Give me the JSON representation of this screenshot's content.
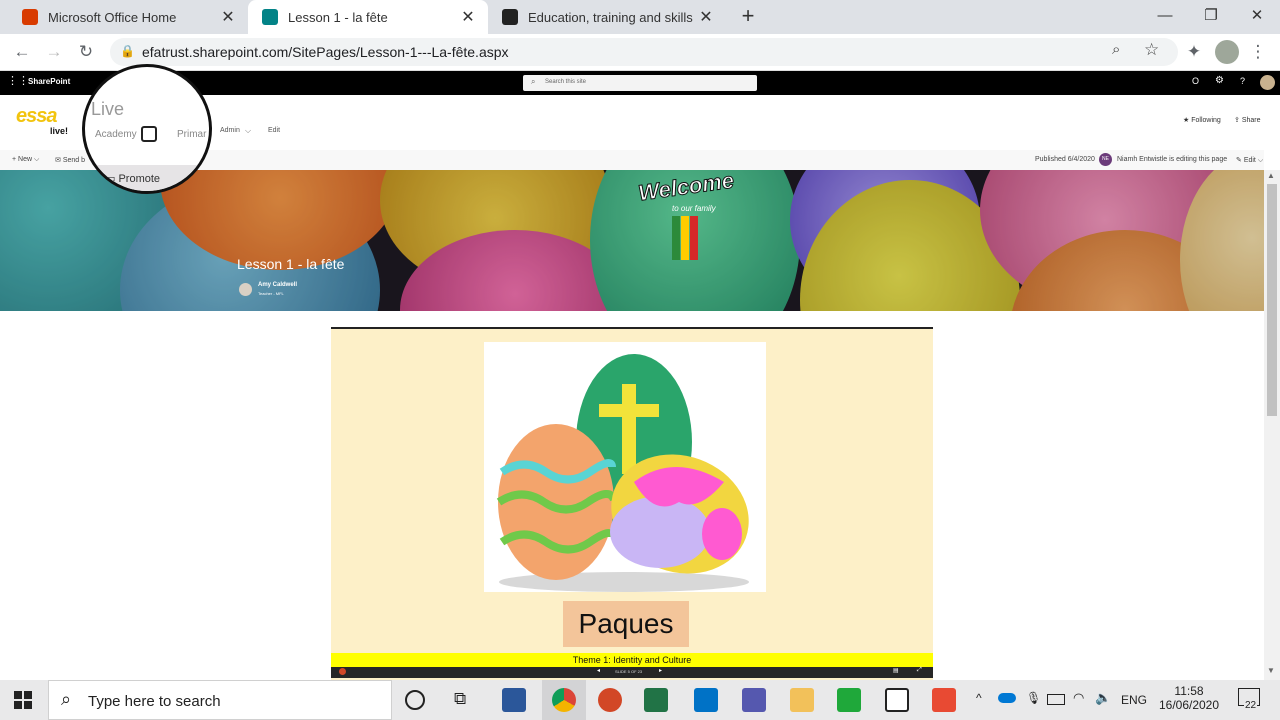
{
  "browser": {
    "tabs": [
      {
        "title": "Microsoft Office Home",
        "active": false
      },
      {
        "title": "Lesson 1 - la fête",
        "active": true
      },
      {
        "title": "Education, training and skills - G",
        "active": false
      }
    ],
    "new_tab": "+",
    "url": "efatrust.sharepoint.com/SitePages/Lesson-1---La-fête.aspx"
  },
  "suitebar": {
    "app_name": "SharePoint",
    "search_placeholder": "Search this site"
  },
  "site": {
    "logo_text": "essa",
    "logo_sub": "live!",
    "nav": [
      "Live",
      "Academy",
      "Primar",
      "Admin",
      "Edit"
    ],
    "following": "Following",
    "share": "Share"
  },
  "commandbar": {
    "new": "New",
    "send": "Send b",
    "promote": "Promote",
    "published": "Published 6/4/2020",
    "editor_initials": "NE",
    "editing": "Niamh Entwistle is editing this page",
    "edit": "Edit"
  },
  "hero": {
    "title": "Lesson 1 - la fête",
    "author": "Amy Caldwell",
    "author_role": "Teacher - MFL",
    "logo_text": "Welcome",
    "logo_sub": "to our family"
  },
  "slide": {
    "heading": "Paques",
    "footer": "Theme 1: Identity and Culture",
    "slide_counter": "SLIDE 5 OF 23"
  },
  "taskbar": {
    "search_placeholder": "Type here to search",
    "language": "ENG",
    "time": "11:58",
    "date": "16/06/2020",
    "notifications": "22"
  },
  "colors": {
    "slide_bg": "#fdf0c8",
    "slide_footer": "#ffff00",
    "heading_box": "#f3c59a",
    "essa_yellow": "#f2c40f"
  }
}
